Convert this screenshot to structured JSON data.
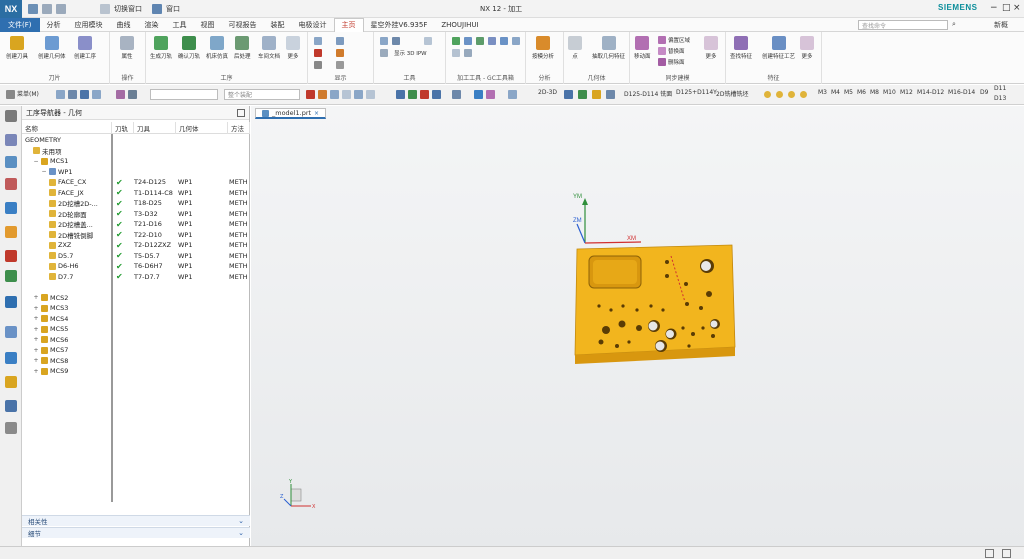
{
  "app": {
    "logo": "NX",
    "window_title": "NX 12 - 加工",
    "brand": "SIEMENS",
    "quick_access": [
      "切换窗口",
      "窗口"
    ]
  },
  "menu": {
    "file": "文件(F)",
    "tabs": [
      "分析",
      "应用模块",
      "曲线",
      "渲染",
      "工具",
      "视图",
      "可视报告",
      "装配",
      "电极设计",
      "主页",
      "星空外挂V6.935F",
      "ZHOUJIHUI"
    ],
    "active_tab": "主页",
    "search_placeholder": "查找命令",
    "right_label": "新概"
  },
  "ribbon": {
    "insert": {
      "label": "刀片",
      "buttons": [
        "创建刀具",
        "创建几何体",
        "创建工序"
      ]
    },
    "operations": {
      "label": "操作",
      "buttons": [
        "属性"
      ]
    },
    "process": {
      "label": "工序",
      "buttons": [
        "生成刀轨",
        "确认刀轨",
        "机床仿真",
        "后处理",
        "车间文档",
        "更多"
      ]
    },
    "display": {
      "label": "显示"
    },
    "tools": {
      "label": "工具",
      "ipw": "显示 3D IPW"
    },
    "gc": {
      "label": "加工工具 - GC工具箱"
    },
    "analysis": {
      "label": "分析",
      "buttons": [
        "按模分析"
      ]
    },
    "geometry": {
      "label": "几何体",
      "buttons": [
        "点",
        "抽取几何特征"
      ]
    },
    "sync": {
      "label": "同步建模",
      "buttons": [
        "移动面",
        "偏置区域",
        "替换面",
        "删除面",
        "更多"
      ]
    },
    "features": {
      "label": "特征",
      "buttons": [
        "查找特征",
        "创建特征工艺",
        "更多"
      ]
    }
  },
  "toolbar": {
    "menu_label": "菜单(M)",
    "filter_placeholder": "",
    "assembly_placeholder": "整个装配",
    "items": [
      "2D-3D",
      "D125-D114 铣面",
      "D125+D114Y",
      "2D铣槽铣坯",
      "M3",
      "M4",
      "M5",
      "M6",
      "M8",
      "M10",
      "M12",
      "M14-D12",
      "M16-D14",
      "D9",
      "D11",
      "D13"
    ]
  },
  "navigator": {
    "title": "工序导航器 - 几何",
    "columns": [
      "名称",
      "刀轨",
      "刀具",
      "几何体",
      "方法"
    ],
    "rows": [
      {
        "indent": 0,
        "name": "GEOMETRY",
        "path": "",
        "tool": "",
        "geom": "",
        "method": "",
        "icon": "none"
      },
      {
        "indent": 1,
        "name": "未用项",
        "path": "",
        "tool": "",
        "geom": "",
        "method": "",
        "icon": "folder"
      },
      {
        "indent": 1,
        "name": "MCS1",
        "path": "",
        "tool": "",
        "geom": "",
        "method": "",
        "icon": "mcs",
        "exp": "−"
      },
      {
        "indent": 2,
        "name": "WP1",
        "path": "",
        "tool": "",
        "geom": "",
        "method": "",
        "icon": "wp",
        "exp": "−"
      },
      {
        "indent": 3,
        "name": "FACE_CX",
        "path": "✔",
        "tool": "T24-D125",
        "geom": "WP1",
        "method": "METH",
        "icon": "op"
      },
      {
        "indent": 3,
        "name": "FACE_JX",
        "path": "✔",
        "tool": "T1-D114-C8",
        "geom": "WP1",
        "method": "METH",
        "icon": "op"
      },
      {
        "indent": 3,
        "name": "2D挖槽2D-...",
        "path": "✔",
        "tool": "T18-D25",
        "geom": "WP1",
        "method": "METH",
        "icon": "op"
      },
      {
        "indent": 3,
        "name": "2D轮廓面",
        "path": "✔",
        "tool": "T3-D32",
        "geom": "WP1",
        "method": "METH",
        "icon": "op"
      },
      {
        "indent": 3,
        "name": "2D挖槽盖...",
        "path": "✔",
        "tool": "T21-D16",
        "geom": "WP1",
        "method": "METH",
        "icon": "op"
      },
      {
        "indent": 3,
        "name": "2D槽铣倒脚",
        "path": "✔",
        "tool": "T22-D10",
        "geom": "WP1",
        "method": "METH",
        "icon": "op"
      },
      {
        "indent": 3,
        "name": "ZXZ",
        "path": "✔",
        "tool": "T2-D12ZXZ",
        "geom": "WP1",
        "method": "METH",
        "icon": "op"
      },
      {
        "indent": 3,
        "name": "D5.7",
        "path": "✔",
        "tool": "T5-D5.7",
        "geom": "WP1",
        "method": "METH",
        "icon": "op"
      },
      {
        "indent": 3,
        "name": "D6-H6",
        "path": "✔",
        "tool": "T6-D6H7",
        "geom": "WP1",
        "method": "METH",
        "icon": "op"
      },
      {
        "indent": 3,
        "name": "D7.7",
        "path": "✔",
        "tool": "T7-D7.7",
        "geom": "WP1",
        "method": "METH",
        "icon": "op"
      },
      {
        "indent": 0,
        "name": "",
        "path": "",
        "tool": "",
        "geom": "",
        "method": "",
        "icon": "none"
      },
      {
        "indent": 1,
        "name": "MCS2",
        "path": "",
        "tool": "",
        "geom": "",
        "method": "",
        "icon": "mcs",
        "exp": "+"
      },
      {
        "indent": 1,
        "name": "MCS3",
        "path": "",
        "tool": "",
        "geom": "",
        "method": "",
        "icon": "mcs",
        "exp": "+"
      },
      {
        "indent": 1,
        "name": "MCS4",
        "path": "",
        "tool": "",
        "geom": "",
        "method": "",
        "icon": "mcs",
        "exp": "+"
      },
      {
        "indent": 1,
        "name": "MCS5",
        "path": "",
        "tool": "",
        "geom": "",
        "method": "",
        "icon": "mcs",
        "exp": "+"
      },
      {
        "indent": 1,
        "name": "MCS6",
        "path": "",
        "tool": "",
        "geom": "",
        "method": "",
        "icon": "mcs",
        "exp": "+"
      },
      {
        "indent": 1,
        "name": "MCS7",
        "path": "",
        "tool": "",
        "geom": "",
        "method": "",
        "icon": "mcs",
        "exp": "+"
      },
      {
        "indent": 1,
        "name": "MCS8",
        "path": "",
        "tool": "",
        "geom": "",
        "method": "",
        "icon": "mcs",
        "exp": "+"
      },
      {
        "indent": 1,
        "name": "MCS9",
        "path": "",
        "tool": "",
        "geom": "",
        "method": "",
        "icon": "mcs",
        "exp": "+"
      }
    ],
    "panels": [
      "相关性",
      "细节"
    ]
  },
  "graphics": {
    "tab_label": "_model1.prt",
    "axes": {
      "x": "XM",
      "y": "YM",
      "z": "ZM"
    },
    "triad": {
      "x": "X",
      "y": "Y",
      "z": "Z"
    }
  },
  "colors": {
    "part": "#f2b51e",
    "part_side": "#d8970f",
    "accent": "#2f6fb0",
    "brand": "#0a8d9a",
    "check": "#1f9a2e"
  }
}
